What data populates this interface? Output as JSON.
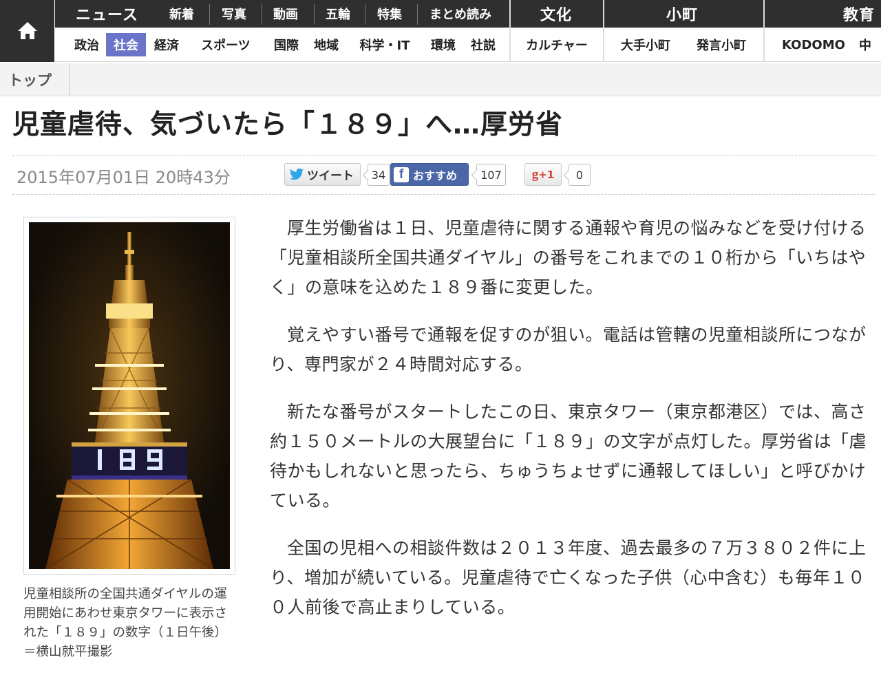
{
  "nav": {
    "home_icon": "home-icon",
    "news_label": "ニュース",
    "news_subtabs": [
      "新着",
      "写真",
      "動画",
      "五輪",
      "特集",
      "まとめ読み"
    ],
    "bunka_label": "文化",
    "komachi_label": "小町",
    "kyoiku_label": "教育",
    "categories": [
      "政治",
      "社会",
      "経済",
      "スポーツ",
      "国際",
      "地域",
      "科学・IT",
      "環境",
      "社説"
    ],
    "active_category": "社会",
    "bunka_sub": "カルチャー",
    "komachi_subs": [
      "大手小町",
      "発言小町"
    ],
    "kyoiku_subs": [
      "KODOMO",
      "中"
    ],
    "active_color": "#6c74c9"
  },
  "breadcrumb": {
    "top": "トップ"
  },
  "article": {
    "title": "児童虐待、気づいたら「１８９」へ…厚労省",
    "date": "2015年07月01日 20時43分",
    "paragraphs": [
      "厚生労働省は１日、児童虐待に関する通報や育児の悩みなどを受け付ける「児童相談所全国共通ダイヤル」の番号をこれまでの１０桁から「いちはやく」の意味を込めた１８９番に変更した。",
      "覚えやすい番号で通報を促すのが狙い。電話は管轄の児童相談所につながり、専門家が２４時間対応する。",
      "新たな番号がスタートしたこの日、東京タワー（東京都港区）では、高さ約１５０メートルの大展望台に「１８９」の文字が点灯した。厚労省は「虐待かもしれないと思ったら、ちゅうちょせずに通報してほしい」と呼びかけている。",
      "全国の児相への相談件数は２０１３年度、過去最多の７万３８０２件に上り、増加が続いている。児童虐待で亡くなった子供（心中含む）も毎年１００人前後で高止まりしている。"
    ],
    "photo_caption": "児童相談所の全国共通ダイヤルの運用開始にあわせ東京タワーに表示された「１８９」の数字（１日午後）＝横山就平撮影"
  },
  "social": {
    "tweet_label": "ツイート",
    "tweet_count": "34",
    "fb_label": "おすすめ",
    "fb_count": "107",
    "gplus_label": "+1",
    "gplus_count": "0"
  }
}
